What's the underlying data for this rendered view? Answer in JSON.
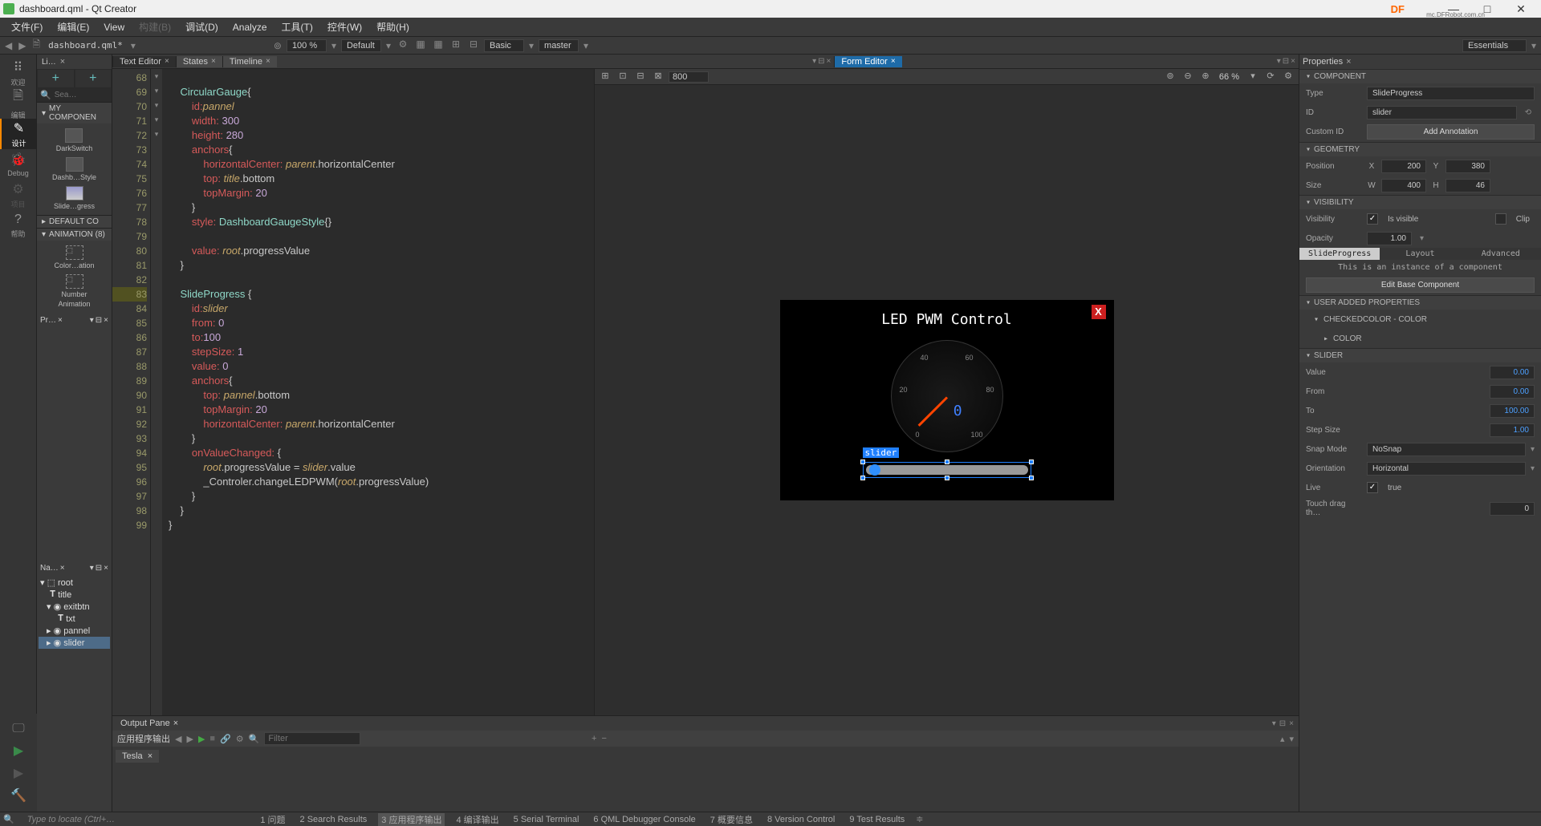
{
  "window": {
    "title": "dashboard.qml - Qt Creator",
    "logo": "DF",
    "sublogo": "mc.DFRobot.com.cn"
  },
  "menu": {
    "file": "文件(F)",
    "edit": "编辑(E)",
    "view": "View",
    "build": "构建(B)",
    "debug": "调试(D)",
    "analyze": "Analyze",
    "tools": "工具(T)",
    "widgets": "控件(W)",
    "help": "帮助(H)"
  },
  "toolbar": {
    "filename": "dashboard.qml*",
    "zoom": "100 %",
    "style": "Default",
    "other": "Basic",
    "branch": "master",
    "side": "Essentials"
  },
  "modes": {
    "welcome": "欢迎",
    "edit": "编辑",
    "design": "设计",
    "debug": "Debug",
    "projects": "项目",
    "help": "帮助"
  },
  "library": {
    "tab": "Li…",
    "search_ph": "Sea…",
    "my": "MY COMPONEN",
    "default": "DEFAULT CO",
    "anim": "ANIMATION (8)",
    "items": {
      "dark": "DarkSwitch",
      "dash": "Dashb…Style",
      "slide": "Slide…gress",
      "color": "Color…ation",
      "number1": "Number",
      "number2": "Animation"
    }
  },
  "nav": {
    "tab_pr": "Pr…",
    "tab_na": "Na…",
    "root": "root",
    "title": "title",
    "exitbtn": "exitbtn",
    "txt": "txt",
    "pannel": "pannel",
    "slider": "slider"
  },
  "editor_tabs": {
    "text": "Text Editor",
    "states": "States",
    "timeline": "Timeline",
    "form": "Form Editor",
    "props": "Properties"
  },
  "code": {
    "lines": [
      "68",
      "69",
      "70",
      "71",
      "72",
      "73",
      "74",
      "75",
      "76",
      "77",
      "78",
      "79",
      "80",
      "81",
      "82",
      "83",
      "84",
      "85",
      "86",
      "87",
      "88",
      "89",
      "90",
      "91",
      "92",
      "93",
      "94",
      "95",
      "96",
      "97",
      "98",
      "99"
    ]
  },
  "form": {
    "width_input": "800",
    "zoom": "66 %",
    "title": "LED PWM Control",
    "gauge_val": "0",
    "slider_label": "slider",
    "ticks": {
      "t0": "0",
      "t20": "20",
      "t40": "40",
      "t60": "60",
      "t80": "80",
      "t100": "100"
    }
  },
  "output": {
    "pane": "Output Pane",
    "run": "应用程序输出",
    "filter_ph": "Filter",
    "proc": "Tesla"
  },
  "props": {
    "component": "COMPONENT",
    "type_l": "Type",
    "type_v": "SlideProgress",
    "id_l": "ID",
    "id_v": "slider",
    "custom_l": "Custom ID",
    "annot": "Add Annotation",
    "geometry": "GEOMETRY",
    "pos_l": "Position",
    "x_l": "X",
    "x_v": "200",
    "y_l": "Y",
    "y_v": "380",
    "size_l": "Size",
    "w_l": "W",
    "w_v": "400",
    "h_l": "H",
    "h_v": "46",
    "visibility": "VISIBILITY",
    "vis_l": "Visibility",
    "isvis": "Is visible",
    "clip": "Clip",
    "opacity_l": "Opacity",
    "opacity_v": "1.00",
    "subtabs": {
      "slide": "SlideProgress",
      "layout": "Layout",
      "adv": "Advanced"
    },
    "note": "This is an instance of a component",
    "editbase": "Edit Base Component",
    "user": "USER ADDED PROPERTIES",
    "checked": "CHECKEDCOLOR - COLOR",
    "color": "COLOR",
    "slider_h": "SLIDER",
    "value_l": "Value",
    "value_v": "0.00",
    "from_l": "From",
    "from_v": "0.00",
    "to_l": "To",
    "to_v": "100.00",
    "step_l": "Step Size",
    "step_v": "1.00",
    "snap_l": "Snap Mode",
    "snap_v": "NoSnap",
    "orient_l": "Orientation",
    "orient_v": "Horizontal",
    "live_l": "Live",
    "live_v": "true",
    "touch_l": "Touch drag th…",
    "touch_v": "0"
  },
  "status": {
    "locate": "Type to locate (Ctrl+…",
    "i1": "1 问题",
    "i2": "2 Search Results",
    "i3": "3 应用程序输出",
    "i4": "4 编译输出",
    "i5": "5 Serial Terminal",
    "i6": "6 QML Debugger Console",
    "i7": "7 概要信息",
    "i8": "8 Version Control",
    "i9": "9 Test Results"
  }
}
